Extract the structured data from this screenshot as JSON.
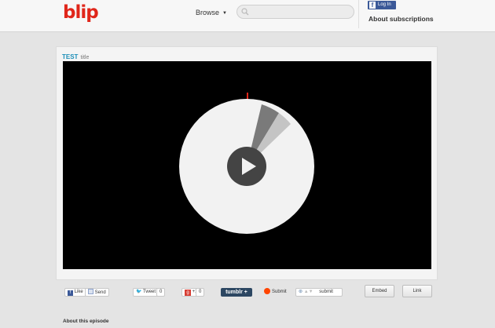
{
  "header": {
    "logo": "blip",
    "browse_label": "Browse",
    "search_placeholder": "",
    "fb_login_label": "Log In",
    "about_subscriptions": "About subscriptions"
  },
  "episode": {
    "brand": "TEST",
    "subtitle": "title"
  },
  "share": {
    "like_label": "Like",
    "send_label": "Send",
    "tweet_label": "Tweet",
    "tweet_count": "0",
    "plusone_label": "+1",
    "plusone_count": "0",
    "tumblr_label": "tumblr",
    "reddit_submit_label": "Submit",
    "digg_submit_label": "submit",
    "embed_label": "Embed",
    "link_label": "Link"
  },
  "footer": {
    "about_episode": "About this episode"
  },
  "colors": {
    "brand_red": "#e0261a",
    "facebook_blue": "#3b5998",
    "title_blue": "#1d8fb8",
    "tumblr_navy": "#2c4762"
  }
}
